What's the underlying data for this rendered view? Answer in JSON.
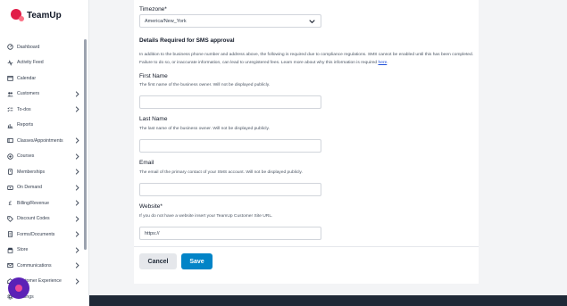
{
  "brand": {
    "name": "TeamUp",
    "primary_color": "#e11d48",
    "accent_color": "#0284c7"
  },
  "sidebar": {
    "items": [
      {
        "label": "Dashboard",
        "icon": "dashboard-icon",
        "has_submenu": false
      },
      {
        "label": "Activity Feed",
        "icon": "activity-icon",
        "has_submenu": false
      },
      {
        "label": "Calendar",
        "icon": "calendar-icon",
        "has_submenu": false
      },
      {
        "label": "Customers",
        "icon": "users-icon",
        "has_submenu": true
      },
      {
        "label": "To-dos",
        "icon": "todo-icon",
        "has_submenu": true
      },
      {
        "label": "Reports",
        "icon": "chart-icon",
        "has_submenu": false
      },
      {
        "label": "Classes/Appointments",
        "icon": "classes-icon",
        "has_submenu": true
      },
      {
        "label": "Courses",
        "icon": "courses-icon",
        "has_submenu": true
      },
      {
        "label": "Memberships",
        "icon": "membership-icon",
        "has_submenu": true
      },
      {
        "label": "On Demand",
        "icon": "on-demand-icon",
        "has_submenu": true
      },
      {
        "label": "Billing/Revenue",
        "icon": "billing-icon",
        "has_submenu": true
      },
      {
        "label": "Discount Codes",
        "icon": "discount-icon",
        "has_submenu": true
      },
      {
        "label": "Forms/Documents",
        "icon": "forms-icon",
        "has_submenu": true
      },
      {
        "label": "Store",
        "icon": "store-icon",
        "has_submenu": true
      },
      {
        "label": "Communications",
        "icon": "mail-icon",
        "has_submenu": true
      },
      {
        "label": "Customer Experience",
        "icon": "experience-icon",
        "has_submenu": true
      },
      {
        "label": "Settings",
        "icon": "gear-icon",
        "has_submenu": false
      }
    ]
  },
  "form": {
    "timezone": {
      "label": "Timezone*",
      "value": "America/New_York"
    },
    "sms": {
      "title": "Details Required for SMS approval",
      "intro_line1": "In addition to the business phone number and address above, the following is required due to compliance regulations. SMS cannot be enabled until this has been completed.",
      "intro_line2": "Failure to do so, or inaccurate information, can lead to unregistered fees. Learn more about why this information is required ",
      "intro_link": "here",
      "intro_end": "."
    },
    "first_name": {
      "label": "First Name",
      "help": "The first name of the business owner. Will not be displayed publicly.",
      "value": ""
    },
    "last_name": {
      "label": "Last Name",
      "help": "The last name of the business owner. Will not be displayed publicly.",
      "value": ""
    },
    "email": {
      "label": "Email",
      "help": "The email of the primary contact of your SMS account. Will not be displayed publicly.",
      "value": ""
    },
    "website": {
      "label": "Website*",
      "help": "If you do not have a website insert your TeamUp Customer Site URL.",
      "value": "https://"
    },
    "cancel_label": "Cancel",
    "save_label": "Save"
  }
}
